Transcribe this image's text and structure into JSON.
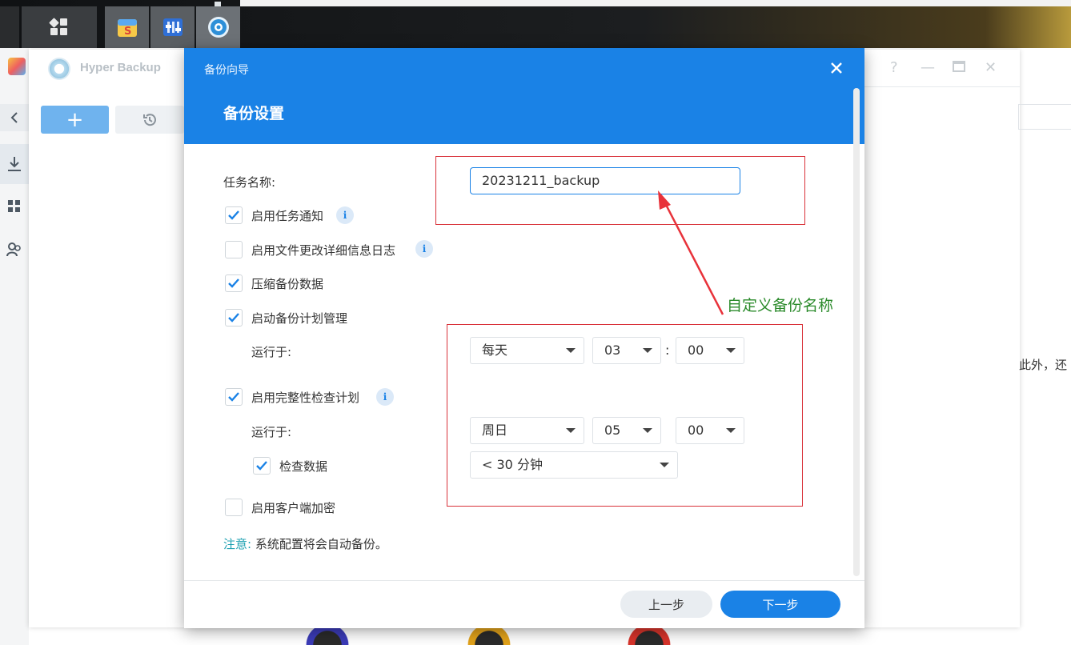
{
  "background_window": {
    "title": "Hyper Backup",
    "side_text": "此外，还"
  },
  "dialog": {
    "window_title": "备份向导",
    "heading": "备份设置",
    "task_name_label": "任务名称:",
    "task_name_value": "20231211_backup",
    "options": {
      "task_notify": {
        "label": "启用任务通知",
        "checked": true
      },
      "file_change_log": {
        "label": "启用文件更改详细信息日志",
        "checked": false
      },
      "compress": {
        "label": "压缩备份数据",
        "checked": true
      },
      "schedule": {
        "label": "启动备份计划管理",
        "checked": true
      },
      "integrity": {
        "label": "启用完整性检查计划",
        "checked": true
      },
      "check_data": {
        "label": "检查数据",
        "checked": true
      },
      "client_encrypt": {
        "label": "启用客户端加密",
        "checked": false
      }
    },
    "schedule_run_label": "运行于:",
    "schedule_day": "每天",
    "schedule_hour": "03",
    "schedule_minute": "00",
    "schedule_colon": ":",
    "integrity_run_label": "运行于:",
    "integrity_day": "周日",
    "integrity_hour": "05",
    "integrity_minute": "00",
    "check_duration": "< 30 分钟",
    "note_prefix": "注意:",
    "note_text": " 系统配置将会自动备份。",
    "prev_button": "上一步",
    "next_button": "下一步"
  },
  "annotation": {
    "text": "自定义备份名称",
    "color": "#2a8a2a",
    "box_color": "#d9323a"
  },
  "colors": {
    "accent": "#1a82e6"
  }
}
